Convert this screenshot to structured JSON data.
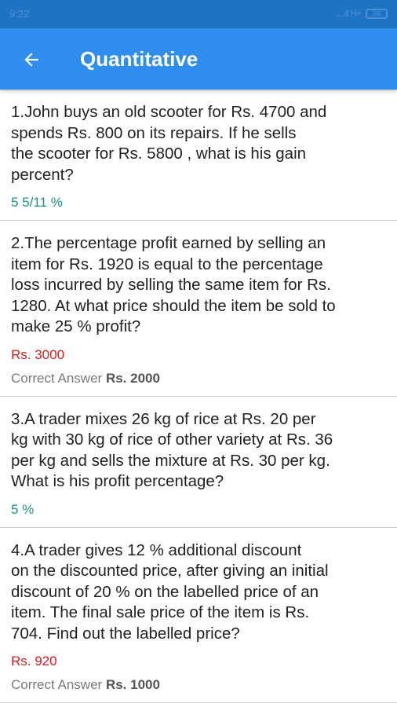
{
  "status_bar": {
    "time": "9:22",
    "signal_text": "....ıll H+",
    "battery_text": "58"
  },
  "app_bar": {
    "title": "Quantitative",
    "back_icon": "arrow-back-icon"
  },
  "colors": {
    "status_bar": "#1f73c4",
    "app_bar": "#2f8ded",
    "correct_answer": "#15957f",
    "wrong_answer": "#e01a1a",
    "correct_label": "#7a7a7a"
  },
  "questions": [
    {
      "text": "1.John buys an old scooter for  Rs.  4700  and\nspends  Rs.  800  on its repairs. If he sells\nthe scooter for  Rs.  5800 ,  what is his gain\npercent?",
      "answer": "5 5/11 %",
      "answer_status": "correct"
    },
    {
      "text": "2.The percentage profit earned by selling an\nitem for  Rs.  1920  is equal to the percentage\nloss incurred by selling the same item for  Rs.\n1280.  At what price should the item be sold to\nmake  25 %  profit?",
      "answer": "Rs.  3000",
      "answer_status": "wrong",
      "correct_label": "Correct Answer",
      "correct_value": "Rs.  2000"
    },
    {
      "text": "3.A trader mixes  26  kg of rice at  Rs.  20  per\nkg with  30  kg of rice of other variety at  Rs.  36\nper kg and sells the mixture at   Rs.  30   per kg.\nWhat is his profit percentage?",
      "answer": "5 %",
      "answer_status": "correct"
    },
    {
      "text": "4.A trader gives  12 %  additional discount\non the discounted price, after giving an initial\ndiscount of  20 %  on the labelled price of an\nitem. The final sale price of the item is  Rs.\n704.  Find out the labelled price?",
      "answer": "Rs.  920",
      "answer_status": "wrong",
      "correct_label": "Correct Answer",
      "correct_value": "Rs.  1000"
    }
  ]
}
